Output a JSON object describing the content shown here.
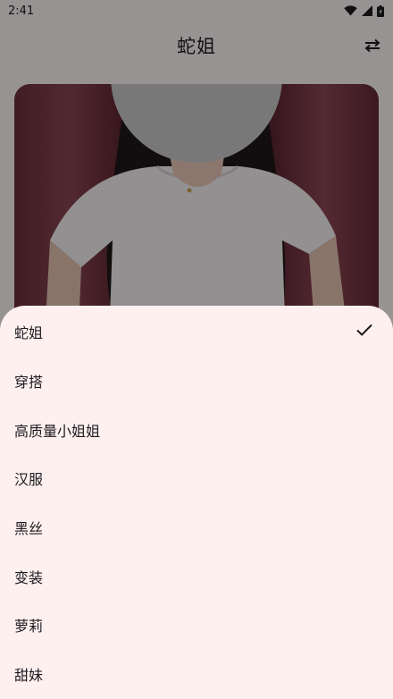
{
  "status_bar": {
    "time": "2:41",
    "icons": [
      "wifi-icon",
      "signal-icon",
      "battery-icon"
    ]
  },
  "app_bar": {
    "title": "蛇姐",
    "action_icon": "swap-icon"
  },
  "photo": {
    "description_icon": "photo"
  },
  "sheet": {
    "items": [
      {
        "label": "蛇姐",
        "selected": true
      },
      {
        "label": "穿搭",
        "selected": false
      },
      {
        "label": "高质量小姐姐",
        "selected": false
      },
      {
        "label": "汉服",
        "selected": false
      },
      {
        "label": "黑丝",
        "selected": false
      },
      {
        "label": "变装",
        "selected": false
      },
      {
        "label": "萝莉",
        "selected": false
      },
      {
        "label": "甜妹",
        "selected": false
      }
    ]
  },
  "colors": {
    "sheet_bg": "#fff0f0",
    "page_bg": "#fdf6f6",
    "text": "#1c1b1f"
  }
}
